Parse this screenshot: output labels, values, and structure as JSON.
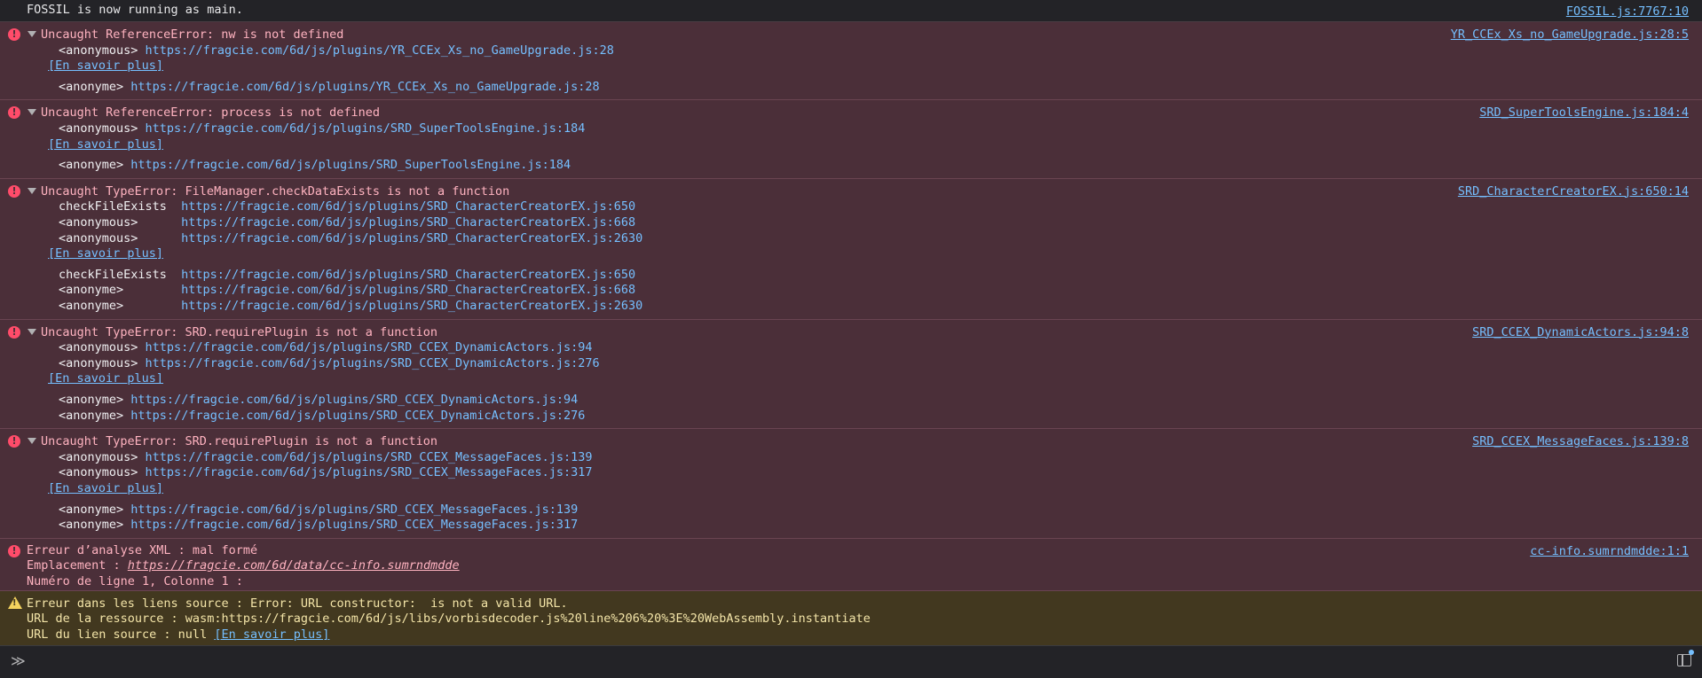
{
  "log": {
    "text": "FOSSIL is now running as main.",
    "source": "FOSSIL.js:7767:10"
  },
  "errors": [
    {
      "title": "Uncaught ReferenceError: nw is not defined",
      "source": "YR_CCEx_Xs_no_GameUpgrade.js:28:5",
      "frames": [
        {
          "fn": "<anonymous>",
          "url": "https://fragcie.com/6d/js/plugins/YR_CCEx_Xs_no_GameUpgrade.js:28"
        }
      ],
      "more": "[En savoir plus]",
      "frames2": [
        {
          "fn": "<anonyme>",
          "url": "https://fragcie.com/6d/js/plugins/YR_CCEx_Xs_no_GameUpgrade.js:28"
        }
      ]
    },
    {
      "title": "Uncaught ReferenceError: process is not defined",
      "source": "SRD_SuperToolsEngine.js:184:4",
      "frames": [
        {
          "fn": "<anonymous>",
          "url": "https://fragcie.com/6d/js/plugins/SRD_SuperToolsEngine.js:184"
        }
      ],
      "more": "[En savoir plus]",
      "frames2": [
        {
          "fn": "<anonyme>",
          "url": "https://fragcie.com/6d/js/plugins/SRD_SuperToolsEngine.js:184"
        }
      ]
    },
    {
      "title": "Uncaught TypeError: FileManager.checkDataExists is not a function",
      "source": "SRD_CharacterCreatorEX.js:650:14",
      "frames": [
        {
          "fn": "checkFileExists",
          "url": "https://fragcie.com/6d/js/plugins/SRD_CharacterCreatorEX.js:650"
        },
        {
          "fn": "<anonymous>",
          "url": "https://fragcie.com/6d/js/plugins/SRD_CharacterCreatorEX.js:668"
        },
        {
          "fn": "<anonymous>",
          "url": "https://fragcie.com/6d/js/plugins/SRD_CharacterCreatorEX.js:2630"
        }
      ],
      "more": "[En savoir plus]",
      "frames2": [
        {
          "fn": "checkFileExists",
          "url": "https://fragcie.com/6d/js/plugins/SRD_CharacterCreatorEX.js:650"
        },
        {
          "fn": "<anonyme>",
          "url": "https://fragcie.com/6d/js/plugins/SRD_CharacterCreatorEX.js:668"
        },
        {
          "fn": "<anonyme>",
          "url": "https://fragcie.com/6d/js/plugins/SRD_CharacterCreatorEX.js:2630"
        }
      ]
    },
    {
      "title": "Uncaught TypeError: SRD.requirePlugin is not a function",
      "source": "SRD_CCEX_DynamicActors.js:94:8",
      "frames": [
        {
          "fn": "<anonymous>",
          "url": "https://fragcie.com/6d/js/plugins/SRD_CCEX_DynamicActors.js:94"
        },
        {
          "fn": "<anonymous>",
          "url": "https://fragcie.com/6d/js/plugins/SRD_CCEX_DynamicActors.js:276"
        }
      ],
      "more": "[En savoir plus]",
      "frames2": [
        {
          "fn": "<anonyme>",
          "url": "https://fragcie.com/6d/js/plugins/SRD_CCEX_DynamicActors.js:94"
        },
        {
          "fn": "<anonyme>",
          "url": "https://fragcie.com/6d/js/plugins/SRD_CCEX_DynamicActors.js:276"
        }
      ]
    },
    {
      "title": "Uncaught TypeError: SRD.requirePlugin is not a function",
      "source": "SRD_CCEX_MessageFaces.js:139:8",
      "frames": [
        {
          "fn": "<anonymous>",
          "url": "https://fragcie.com/6d/js/plugins/SRD_CCEX_MessageFaces.js:139"
        },
        {
          "fn": "<anonymous>",
          "url": "https://fragcie.com/6d/js/plugins/SRD_CCEX_MessageFaces.js:317"
        }
      ],
      "more": "[En savoir plus]",
      "frames2": [
        {
          "fn": "<anonyme>",
          "url": "https://fragcie.com/6d/js/plugins/SRD_CCEX_MessageFaces.js:139"
        },
        {
          "fn": "<anonyme>",
          "url": "https://fragcie.com/6d/js/plugins/SRD_CCEX_MessageFaces.js:317"
        }
      ]
    }
  ],
  "xml_error": {
    "line1": "Erreur d’analyse XML : mal formé",
    "line2_label": "Emplacement : ",
    "line2_link": "https://fragcie.com/6d/data/cc-info.sumrndmdde",
    "line3": "Numéro de ligne 1, Colonne 1 :",
    "source": "cc-info.sumrndmdde:1:1"
  },
  "warning": {
    "line1": "Erreur dans les liens source : Error: URL constructor:  is not a valid URL.",
    "line2": "URL de la ressource : wasm:https://fragcie.com/6d/js/libs/vorbisdecoder.js%20line%206%20%3E%20WebAssembly.instantiate",
    "line3": "URL du lien source : null ",
    "more": "[En savoir plus]"
  },
  "prompt": {
    "chevron": "≫"
  }
}
